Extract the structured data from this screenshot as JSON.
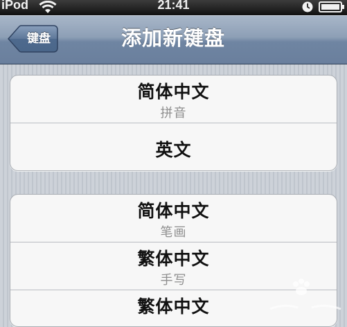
{
  "status_bar": {
    "carrier": "iPod",
    "time": "21:41",
    "wifi_icon": "wifi-icon",
    "clock_icon": "clock-icon",
    "battery_icon": "battery-icon"
  },
  "nav_bar": {
    "back_label": "键盘",
    "title": "添加新键盘"
  },
  "groups": [
    {
      "cells": [
        {
          "title": "简体中文",
          "subtitle": "拼音"
        },
        {
          "title": "英文"
        }
      ]
    },
    {
      "cells": [
        {
          "title": "简体中文",
          "subtitle": "笔画"
        },
        {
          "title": "繁体中文",
          "subtitle": "手写"
        },
        {
          "title": "繁体中文"
        }
      ]
    }
  ],
  "colors": {
    "nav_bar": "#8d9fb6",
    "background": "#cdd2d9",
    "cell_background": "#f7f7f7",
    "subtitle_text": "#8e8e8e"
  }
}
